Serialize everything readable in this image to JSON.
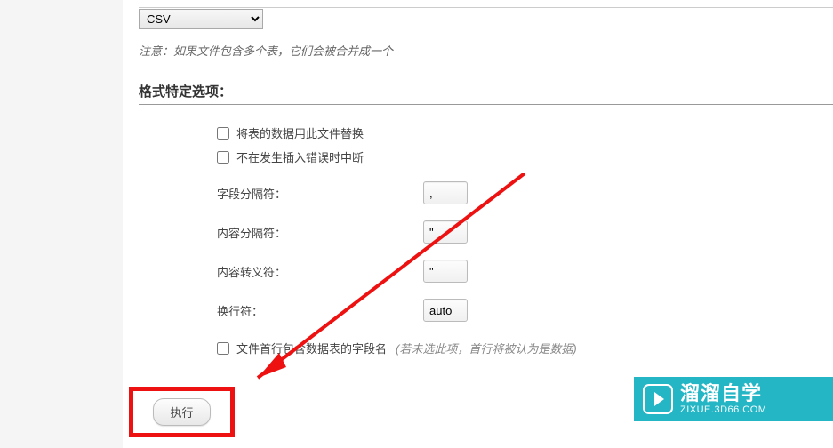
{
  "format": {
    "selected": "CSV"
  },
  "note_text": "注意：如果文件包含多个表，它们会被合并成一个",
  "section_title": "格式特定选项：",
  "check_replace": "将表的数据用此文件替换",
  "check_noabort": "不在发生插入错误时中断",
  "field_sep": {
    "label": "字段分隔符：",
    "value": ","
  },
  "content_sep": {
    "label": "内容分隔符：",
    "value": "\""
  },
  "escape_char": {
    "label": "内容转义符：",
    "value": "\""
  },
  "line_term": {
    "label": "换行符：",
    "value": "auto"
  },
  "first_row_cols": {
    "label": "文件首行包含数据表的字段名",
    "hint": "(若未选此项，首行将被认为是数据)"
  },
  "execute_label": "执行",
  "watermark": {
    "brand": "溜溜自学",
    "url": "ZIXUE.3D66.COM"
  }
}
